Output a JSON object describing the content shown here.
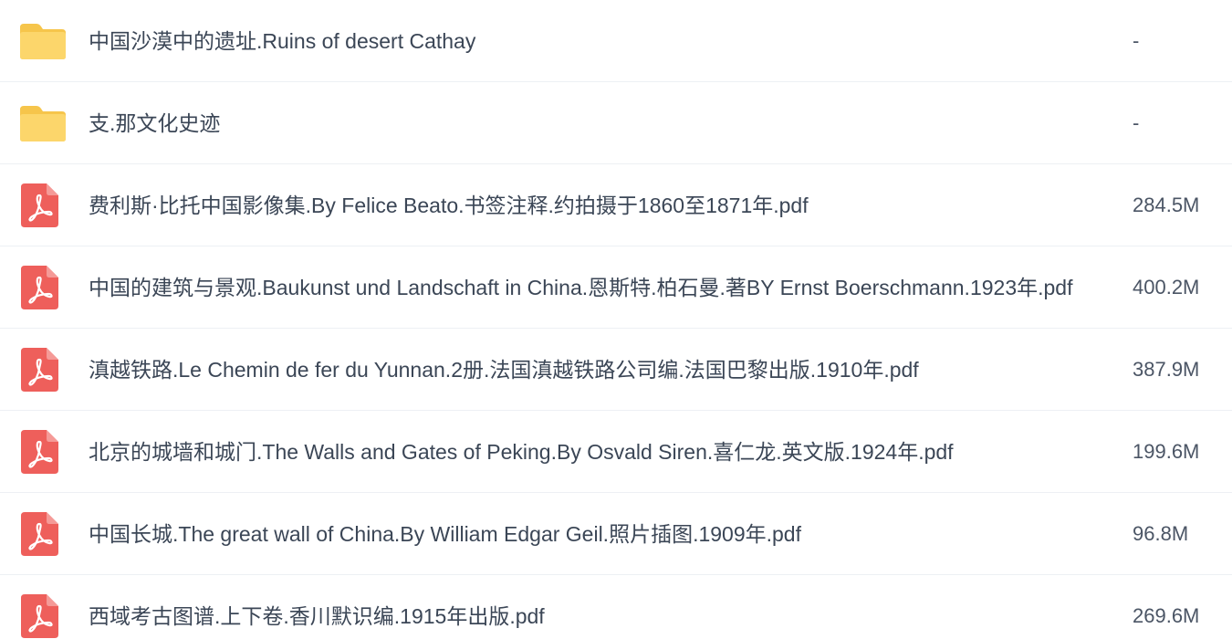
{
  "files": [
    {
      "type": "folder",
      "icon": "folder-icon",
      "name": "中国沙漠中的遗址.Ruins of desert Cathay",
      "size": "-"
    },
    {
      "type": "folder",
      "icon": "folder-icon",
      "name": "支.那文化史迹",
      "size": "-"
    },
    {
      "type": "pdf",
      "icon": "pdf-icon",
      "name": "费利斯·比托中国影像集.By Felice Beato.书签注释.约拍摄于1860至1871年.pdf",
      "size": "284.5M"
    },
    {
      "type": "pdf",
      "icon": "pdf-icon",
      "name": "中国的建筑与景观.Baukunst und Landschaft in China.恩斯特.柏石曼.著BY Ernst Boerschmann.1923年.pdf",
      "size": "400.2M"
    },
    {
      "type": "pdf",
      "icon": "pdf-icon",
      "name": "滇越铁路.Le Chemin de fer du Yunnan.2册.法国滇越铁路公司编.法国巴黎出版.1910年.pdf",
      "size": "387.9M"
    },
    {
      "type": "pdf",
      "icon": "pdf-icon",
      "name": "北京的城墙和城门.The Walls and Gates of Peking.By Osvald Siren.喜仁龙.英文版.1924年.pdf",
      "size": "199.6M"
    },
    {
      "type": "pdf",
      "icon": "pdf-icon",
      "name": "中国长城.The great wall of China.By William Edgar Geil.照片插图.1909年.pdf",
      "size": "96.8M"
    },
    {
      "type": "pdf",
      "icon": "pdf-icon",
      "name": "西域考古图谱.上下卷.香川默识编.1915年出版.pdf",
      "size": "269.6M"
    }
  ],
  "colors": {
    "folder": "#fcd66b",
    "pdf": "#ee5f5b",
    "text": "#3b4656",
    "divider": "#edf0f4"
  }
}
